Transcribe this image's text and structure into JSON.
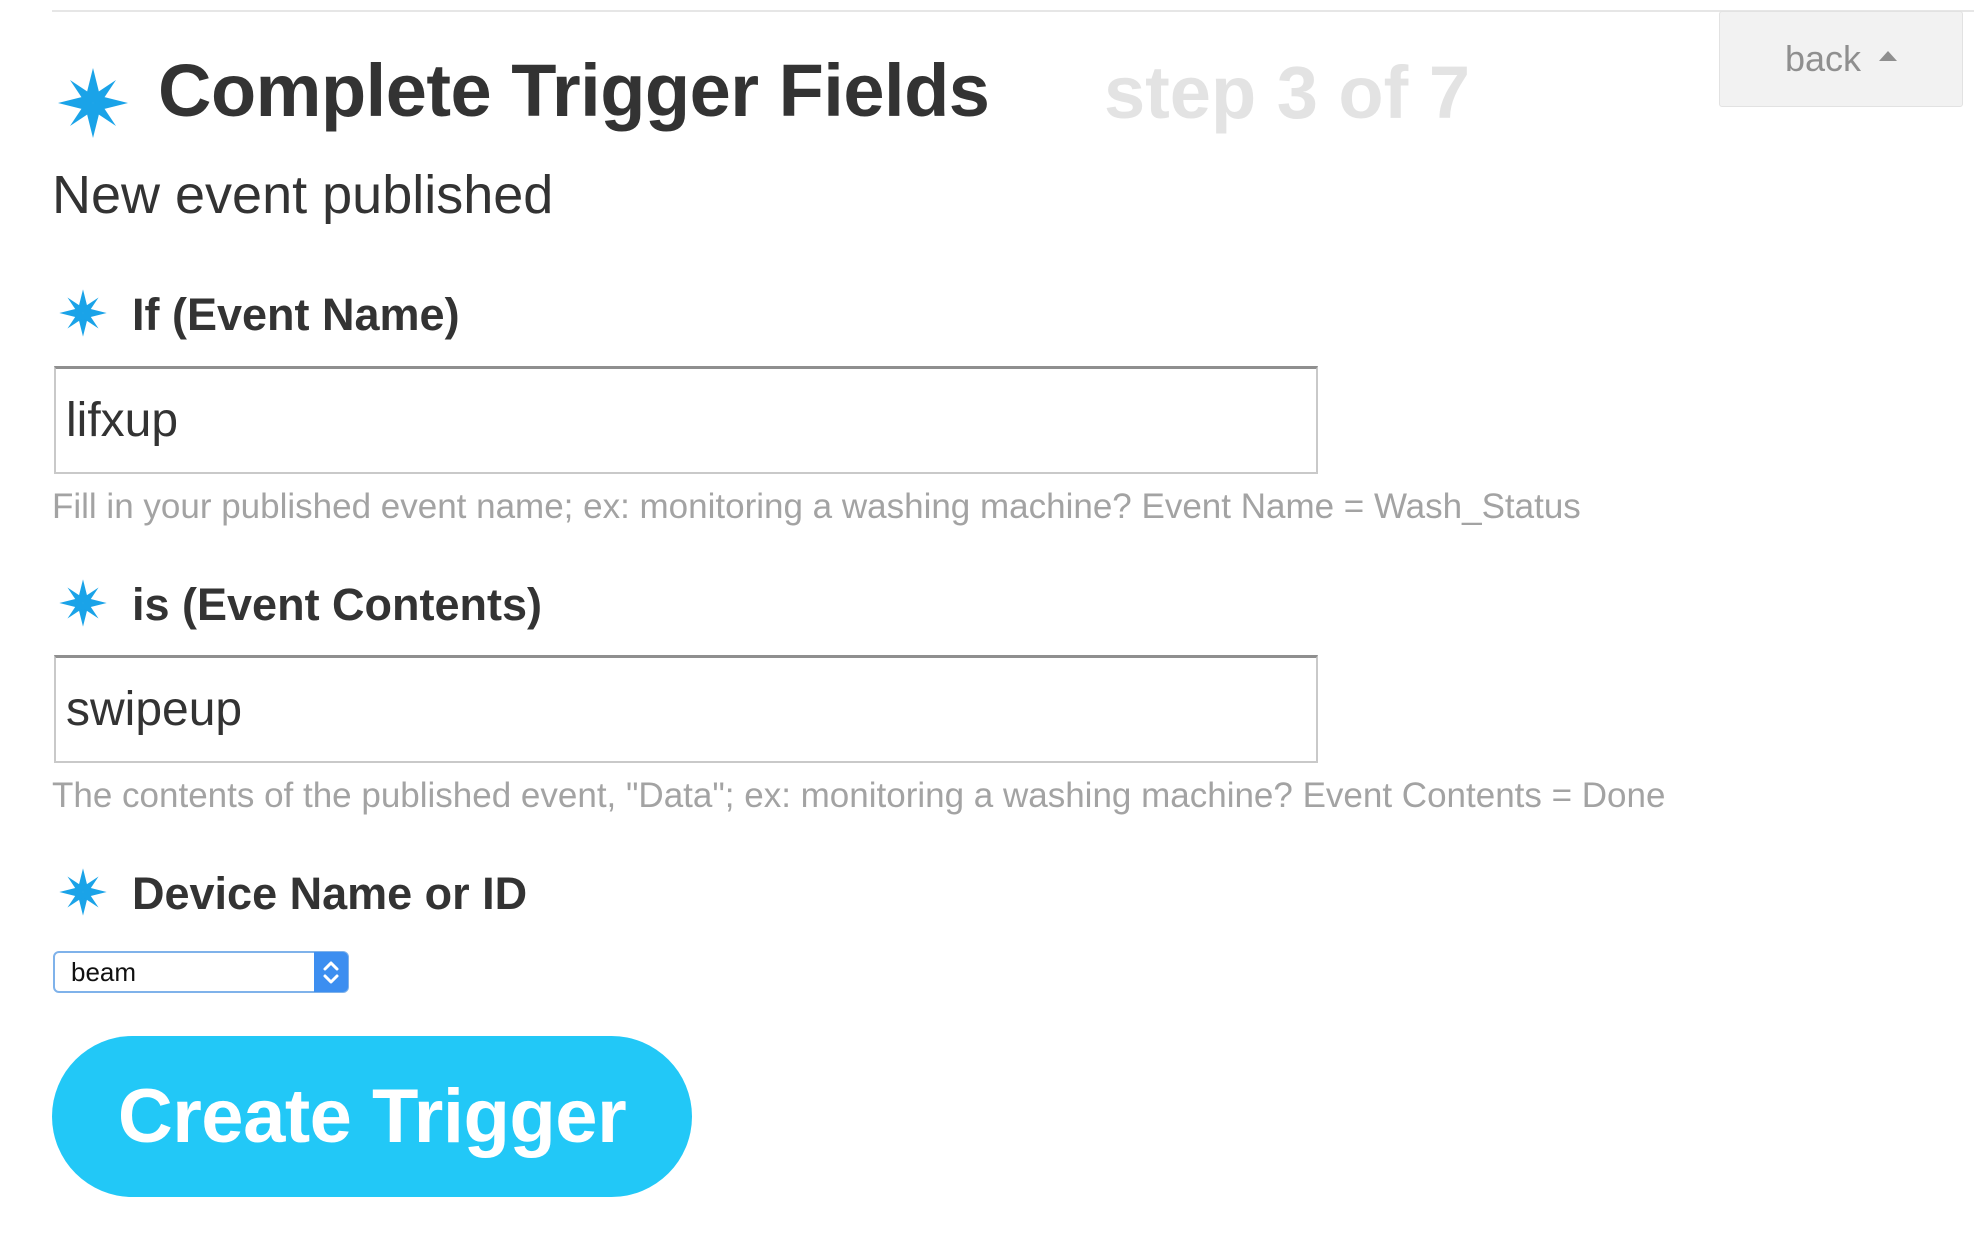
{
  "header": {
    "title": "Complete Trigger Fields",
    "step": "step 3 of 7",
    "back_label": "back",
    "title_icon": "star-icon"
  },
  "subtitle": "New event published",
  "fields": [
    {
      "label": "If (Event Name)",
      "value": "lifxup",
      "helper": "Fill in your published event name; ex: monitoring a washing machine? Event Name = Wash_Status",
      "icon": "star-icon"
    },
    {
      "label": "is (Event Contents)",
      "value": "swipeup",
      "helper": "The contents of the published event, \"Data\"; ex: monitoring a washing machine? Event Contents = Done",
      "icon": "star-icon"
    },
    {
      "label": "Device Name or ID",
      "value": "beam",
      "icon": "star-icon"
    }
  ],
  "submit_label": "Create Trigger",
  "colors": {
    "accent": "#22c8f7",
    "star": "#1aa3e8",
    "text": "#333333",
    "muted": "#a3a3a3",
    "step": "#e3e3e3"
  }
}
